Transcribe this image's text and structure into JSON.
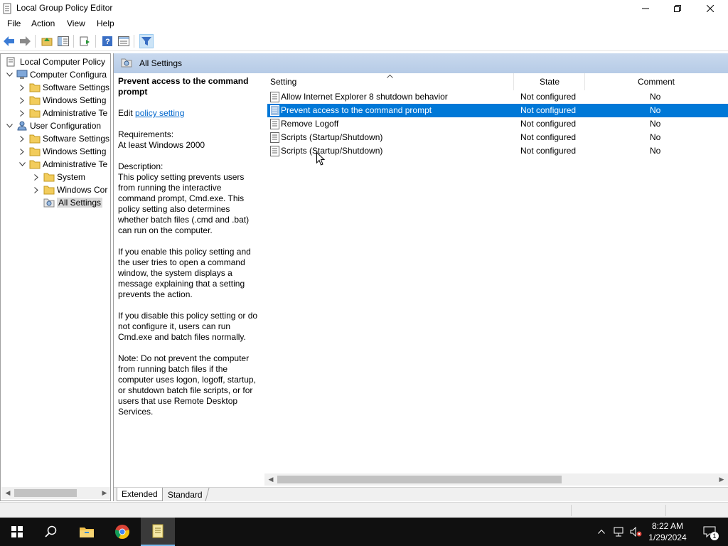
{
  "window": {
    "title": "Local Group Policy Editor"
  },
  "menu": [
    "File",
    "Action",
    "View",
    "Help"
  ],
  "tree": {
    "root": "Local Computer Policy",
    "computer_config": "Computer Configura",
    "cc_software": "Software Settings",
    "cc_windows": "Windows Setting",
    "cc_admin": "Administrative Te",
    "user_config": "User Configuration",
    "uc_software": "Software Settings",
    "uc_windows": "Windows Setting",
    "uc_admin": "Administrative Te",
    "uc_system": "System",
    "uc_wincomp": "Windows Cor",
    "uc_all": "All Settings"
  },
  "header": {
    "title": "All Settings"
  },
  "description": {
    "heading": "Prevent access to the command prompt",
    "edit_prefix": "Edit ",
    "edit_link": "policy setting ",
    "requirements": "Requirements:\nAt least Windows 2000",
    "description": "Description:\nThis policy setting prevents users from running the interactive command prompt, Cmd.exe.  This policy setting also determines whether batch files (.cmd and .bat) can run on the computer.",
    "enable_text": "If you enable this policy setting and the user tries to open a command window, the system displays a message explaining that a setting prevents the action.",
    "disable_text": "If you disable this policy setting or do not configure it, users can run Cmd.exe and batch files normally.",
    "note_text": "Note: Do not prevent the computer from running batch files if the computer uses logon, logoff, startup, or shutdown batch file scripts, or for users that use Remote Desktop Services."
  },
  "columns": {
    "setting": "Setting",
    "state": "State",
    "comment": "Comment"
  },
  "rows": [
    {
      "setting": "Allow Internet Explorer 8 shutdown behavior",
      "state": "Not configured",
      "comment": "No"
    },
    {
      "setting": "Prevent access to the command prompt",
      "state": "Not configured",
      "comment": "No"
    },
    {
      "setting": "Remove Logoff",
      "state": "Not configured",
      "comment": "No"
    },
    {
      "setting": "Scripts (Startup/Shutdown)",
      "state": "Not configured",
      "comment": "No"
    },
    {
      "setting": "Scripts (Startup/Shutdown)",
      "state": "Not configured",
      "comment": "No"
    }
  ],
  "tabs": {
    "extended": "Extended",
    "standard": "Standard"
  },
  "clock": {
    "time": "8:22 AM",
    "date": "1/29/2024"
  },
  "notifications": {
    "count": "1"
  },
  "colors": {
    "selection": "#0078d7",
    "header_band": "#c9d9ee",
    "taskbar": "#101010"
  }
}
